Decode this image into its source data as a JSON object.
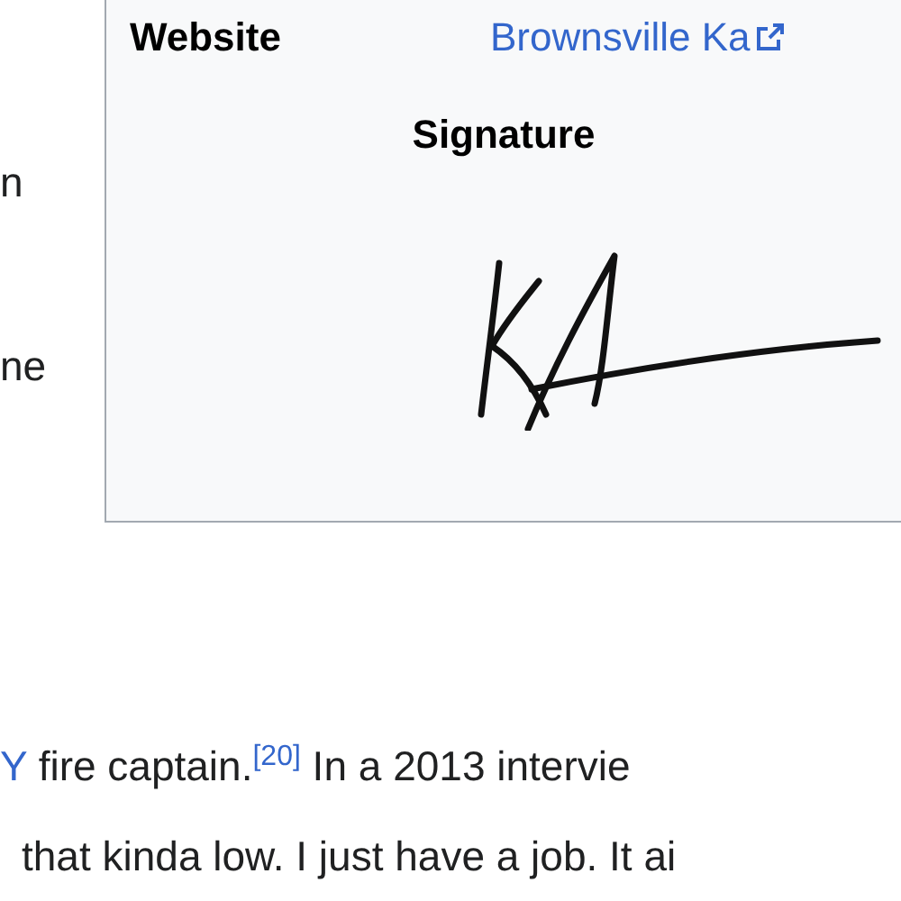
{
  "left_column_fragments": [
    "n",
    "ne"
  ],
  "infobox": {
    "rows": [
      {
        "label": "Website",
        "value": "Brownsville Ka",
        "external": true
      }
    ],
    "signature": {
      "heading": "Signature"
    }
  },
  "body": {
    "lines": [
      {
        "parts": [
          {
            "text": "Y",
            "kind": "link"
          },
          {
            "text": " fire captain.",
            "kind": "text"
          },
          {
            "text": "[20]",
            "kind": "ref"
          },
          {
            "text": " In a 2013 intervie",
            "kind": "text"
          }
        ]
      },
      {
        "parts": [
          {
            "text": "that kinda low. I just have a job. It ai",
            "kind": "text"
          }
        ]
      }
    ]
  }
}
